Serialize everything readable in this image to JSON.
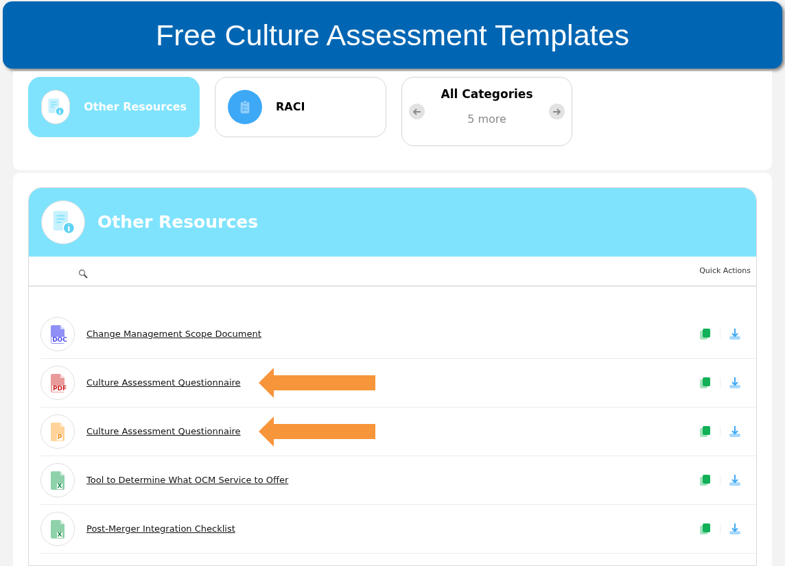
{
  "banner": {
    "title": "Free Culture Assessment Templates"
  },
  "categories": [
    {
      "kind": "info",
      "label": "Other Resources",
      "selected": true
    },
    {
      "kind": "clipboard",
      "label": "RACI",
      "selected": false
    },
    {
      "kind": "carousel",
      "label": "All Categories",
      "more": "5 more",
      "selected": false
    }
  ],
  "section": {
    "title": "Other Resources",
    "table": {
      "columns": {
        "quick_actions": "Quick Actions"
      },
      "rows": [
        {
          "kind": "doc",
          "badge": "DOC",
          "title": "Change Management Scope Document",
          "highlighted": false
        },
        {
          "kind": "pdf",
          "badge": "PDF",
          "title": "Culture Assessment Questionnaire",
          "highlighted": true
        },
        {
          "kind": "ppt",
          "badge": "P",
          "title": "Culture Assessment Questionnaire",
          "highlighted": true
        },
        {
          "kind": "xls",
          "badge": "X",
          "title": "Tool to Determine What OCM Service to Offer",
          "highlighted": false
        },
        {
          "kind": "xls",
          "badge": "X",
          "title": "Post-Merger Integration Checklist",
          "highlighted": false
        }
      ]
    }
  }
}
